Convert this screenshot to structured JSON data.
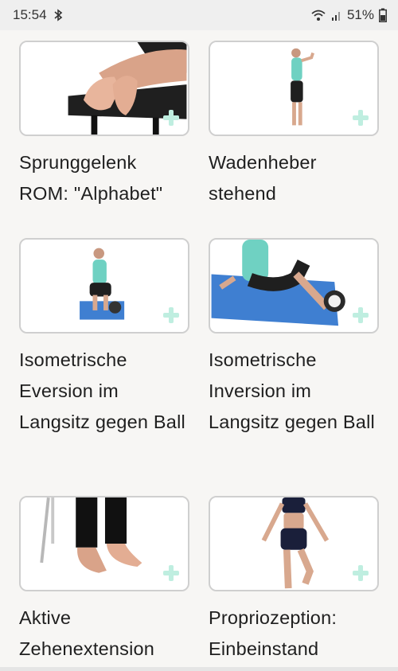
{
  "status_bar": {
    "time": "15:54",
    "battery": "51%",
    "icons": [
      "bluetooth-icon",
      "wifi-icon",
      "signal-icon",
      "battery-icon"
    ]
  },
  "exercises": [
    {
      "title": "Sprunggelenk ROM: \"Alphabet\""
    },
    {
      "title": "Wadenheber stehend"
    },
    {
      "title": "Isometrische Eversion im Langsitz gegen Ball"
    },
    {
      "title": "Isometrische Inversion im Langsitz gegen Ball"
    },
    {
      "title": "Aktive Zehenextension"
    },
    {
      "title": "Propriozeption: Einbeinstand"
    }
  ],
  "colors": {
    "background": "#f7f6f4",
    "card_border": "#cfcfcf",
    "add_icon": "#bfeee0",
    "accent_shirt": "#6fd1c2",
    "mat_blue": "#3f7fd1"
  }
}
